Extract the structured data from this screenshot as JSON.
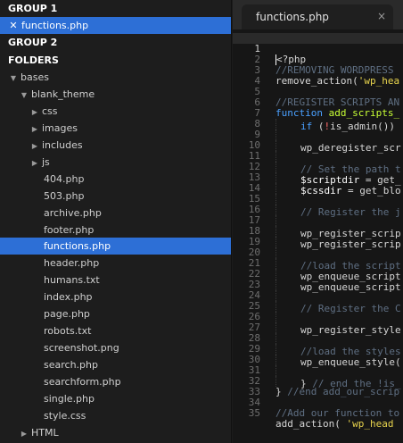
{
  "sidebar": {
    "group1_label": "GROUP 1",
    "open_file": "functions.php",
    "group2_label": "GROUP 2",
    "folders_label": "FOLDERS",
    "tree": {
      "bases": "bases",
      "blank_theme": "blank_theme",
      "folders": [
        "css",
        "images",
        "includes",
        "js"
      ],
      "files": [
        "404.php",
        "503.php",
        "archive.php",
        "footer.php",
        "functions.php",
        "header.php",
        "humans.txt",
        "index.php",
        "page.php",
        "robots.txt",
        "screenshot.png",
        "search.php",
        "searchform.php",
        "single.php",
        "style.css"
      ],
      "html": "HTML"
    }
  },
  "editor": {
    "tab_label": "functions.php",
    "close_glyph": "×",
    "line_numbers": [
      "1",
      "2",
      "3",
      "4",
      "5",
      "6",
      "7",
      "8",
      "9",
      "10",
      "11",
      "12",
      "13",
      "14",
      "15",
      "16",
      "17",
      "18",
      "19",
      "20",
      "21",
      "22",
      "23",
      "24",
      "25",
      "26",
      "27",
      "28",
      "29",
      "30",
      "31",
      "32",
      "33",
      "34",
      "35"
    ],
    "code": {
      "l1": "<?php",
      "l2": "//REMOVING WORDPRESS",
      "l3a": "remove_action(",
      "l3b": "'wp_hea",
      "l5": "//REGISTER SCRIPTS AN",
      "l6a": "function",
      "l6b": " add_scripts_",
      "l7a": "if",
      "l7b": " (",
      "l7c": "!",
      "l7d": "is_admin())",
      "l9": "wp_deregister_scr",
      "l11": "// Set the path t",
      "l12a": "$scriptdir",
      "l12b": " = get_",
      "l13a": "$cssdir",
      "l13b": " = get_blo",
      "l15": "// Register the j",
      "l17": "wp_register_scrip",
      "l18": "wp_register_scrip",
      "l20": "//load the script",
      "l21": "wp_enqueue_script",
      "l22": "wp_enqueue_script",
      "l24": "// Register the C",
      "l26": "wp_register_style",
      "l28": "//load the styles",
      "l29": "wp_enqueue_style(",
      "l31a": "}",
      "l31b": " // end the !is_",
      "l32a": "}",
      "l32b": " //end add_our_scrip",
      "l34": "//Add our function to",
      "l35a": "add_action(",
      "l35b": " 'wp_head"
    }
  },
  "colors": {
    "selection": "#2d6fd6",
    "comment": "#5f6f83",
    "keyword": "#4aa0ff",
    "function_name": "#c8ff35",
    "string": "#e8d44d"
  }
}
